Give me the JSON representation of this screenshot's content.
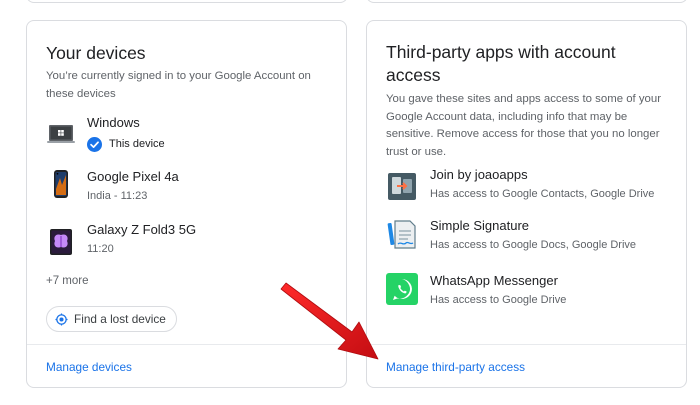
{
  "devices_card": {
    "title": "Your devices",
    "description": "You’re currently signed in to your Google Account on these devices",
    "devices": [
      {
        "name": "Windows",
        "status": "This device",
        "icon": "windows-laptop-icon"
      },
      {
        "name": "Google Pixel 4a",
        "status": "India - 11:23",
        "icon": "phone-icon"
      },
      {
        "name": "Galaxy Z Fold3 5G",
        "status": "11:20",
        "icon": "foldable-phone-icon"
      }
    ],
    "more_label": "+7 more",
    "find_device_label": "Find a lost device",
    "manage_link": "Manage devices"
  },
  "apps_card": {
    "title": "Third-party apps with account access",
    "description": "You gave these sites and apps access to some of your Google Account data, including info that may be sensitive. Remove access for those that you no longer trust or use.",
    "apps": [
      {
        "name": "Join by joaoapps",
        "access": "Has access to Google Contacts, Google Drive",
        "icon": "join-app-icon"
      },
      {
        "name": "Simple Signature",
        "access": "Has access to Google Docs, Google Drive",
        "icon": "signature-app-icon"
      },
      {
        "name": "WhatsApp Messenger",
        "access": "Has access to Google Drive",
        "icon": "whatsapp-icon"
      }
    ],
    "manage_link": "Manage third-party access"
  },
  "colors": {
    "link": "#1a73e8",
    "annotation_arrow": "#e3161b",
    "whatsapp": "#25d366"
  }
}
